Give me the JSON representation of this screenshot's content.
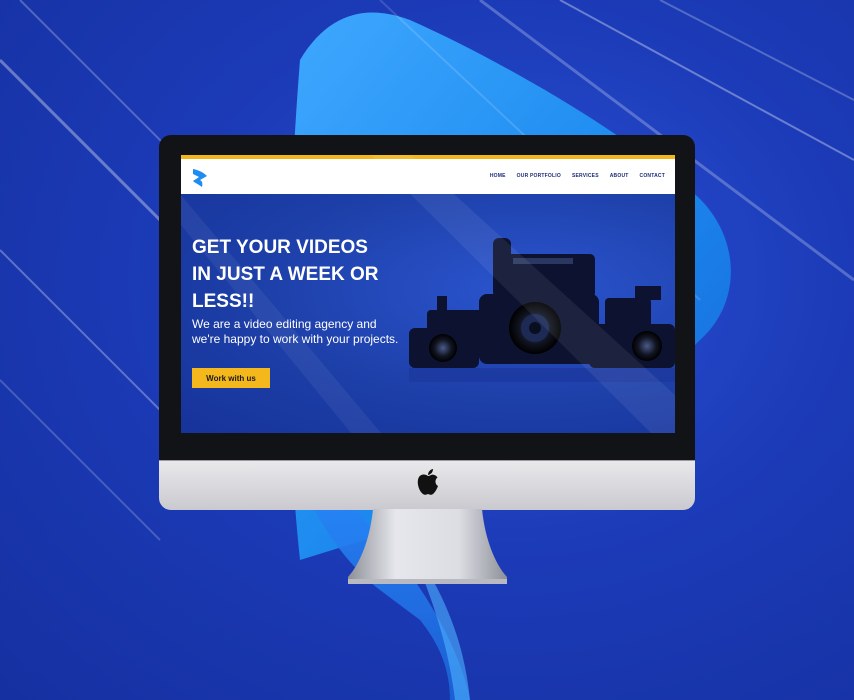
{
  "site": {
    "nav": [
      "HOME",
      "OUR PORTFOLIO",
      "SERVICES",
      "ABOUT",
      "CONTACT"
    ],
    "headline": [
      "GET YOUR VIDEOS",
      "IN JUST A WEEK OR",
      "LESS!!"
    ],
    "subtext": [
      "We are a video editing agency and",
      "we're happy to work with your projects."
    ],
    "cta_label": "Work with us"
  },
  "colors": {
    "accent": "#f5b81c",
    "brand_blue": "#1d3fa8",
    "nav_text": "#1b2b78",
    "background": "#1c3bb8"
  },
  "icons": {
    "site_logo": "play-arrow-logo-icon",
    "device_logo": "apple-logo-icon"
  }
}
